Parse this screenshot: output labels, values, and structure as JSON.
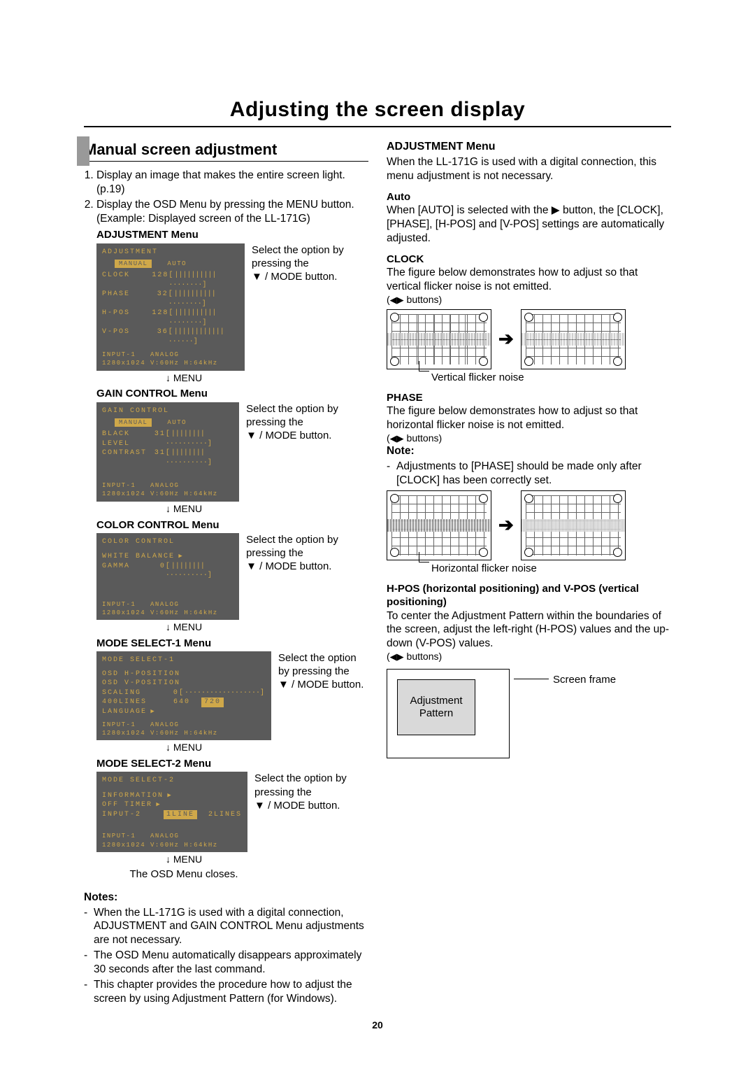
{
  "page_number": "20",
  "title": "Adjusting the screen display",
  "left": {
    "section_title": "Manual screen adjustment",
    "steps": [
      "Display an image that makes the entire screen light. (p.19)",
      "Display the OSD Menu by pressing the MENU button."
    ],
    "example_line": "(Example: Displayed screen of the LL-171G)",
    "side_text_select": "Select the option by pressing the ",
    "side_text_mode": " / MODE button.",
    "menu_arrow_label": " MENU",
    "osd_close": "The OSD Menu closes.",
    "menus": {
      "adjustment": {
        "label": "ADJUSTMENT Menu",
        "osd_title": "ADJUSTMENT",
        "tab_manual": "MANUAL",
        "tab_auto": "AUTO",
        "rows": [
          {
            "k": "CLOCK",
            "v": "128"
          },
          {
            "k": "PHASE",
            "v": "32"
          },
          {
            "k": "H-POS",
            "v": "128"
          },
          {
            "k": "V-POS",
            "v": "36"
          }
        ]
      },
      "gain": {
        "label": "GAIN CONTROL Menu",
        "osd_title": "GAIN CONTROL",
        "tab_manual": "MANUAL",
        "tab_auto": "AUTO",
        "rows": [
          {
            "k": "BLACK LEVEL",
            "v": "31"
          },
          {
            "k": "CONTRAST",
            "v": "31"
          }
        ]
      },
      "color": {
        "label": "COLOR CONTROL Menu",
        "osd_title": "COLOR CONTROL",
        "rows_special": {
          "wb": "WHITE BALANCE",
          "gamma_k": "GAMMA",
          "gamma_v": "0"
        }
      },
      "mode1": {
        "label": "MODE SELECT-1 Menu",
        "osd_title": "MODE SELECT-1",
        "rows_text": [
          "OSD H-POSITION",
          "OSD V-POSITION"
        ],
        "scaling_k": "SCALING",
        "scaling_v": "0",
        "lines_k": "400LINES",
        "lines_a": "640",
        "lines_b": "720",
        "lang": "LANGUAGE"
      },
      "mode2": {
        "label": "MODE SELECT-2 Menu",
        "osd_title": "MODE SELECT-2",
        "info": "INFORMATION",
        "off": "OFF TIMER",
        "input2_k": "INPUT-2",
        "input2_a": "1LINE",
        "input2_b": "2LINES"
      },
      "footer_l1_a": "INPUT-1",
      "footer_l1_b": "ANALOG",
      "footer_l2": "1280x1024   V:60Hz   H:64kHz"
    },
    "notes_h": "Notes:",
    "notes": [
      "When the LL-171G is used with a digital connection, ADJUSTMENT and GAIN CONTROL Menu adjustments are not necessary.",
      "The OSD Menu automatically disappears approximately 30 seconds after the last command.",
      "This chapter provides the procedure how to adjust the screen by using Adjustment Pattern (for Windows)."
    ]
  },
  "right": {
    "adj_h": "ADJUSTMENT Menu",
    "adj_p": "When the LL-171G is used with a digital connection, this menu adjustment is not necessary.",
    "auto_h": "Auto",
    "auto_p1": "When [AUTO] is selected with the ",
    "auto_p2": " button, the [CLOCK], [PHASE], [H-POS] and [V-POS] settings are automatically adjusted.",
    "clock_h": "CLOCK",
    "clock_p": "The figure below demonstrates how to adjust so that vertical flicker noise is not emitted.",
    "buttons_lr": " buttons)",
    "clock_cap": "Vertical flicker noise",
    "phase_h": "PHASE",
    "phase_p": "The figure below demonstrates how to adjust so that horizontal flicker noise is not emitted.",
    "note_h": "Note:",
    "phase_note": "Adjustments to [PHASE] should be made only after [CLOCK] has been correctly set.",
    "phase_cap": "Horizontal flicker noise",
    "hpos_h": "H-POS (horizontal positioning) and V-POS (vertical positioning)",
    "hpos_p": "To center the Adjustment Pattern within the boundaries of the screen, adjust the left-right (H-POS) values and the up-down (V-POS) values.",
    "screen_frame": "Screen frame",
    "adj_pattern": "Adjustment Pattern"
  }
}
